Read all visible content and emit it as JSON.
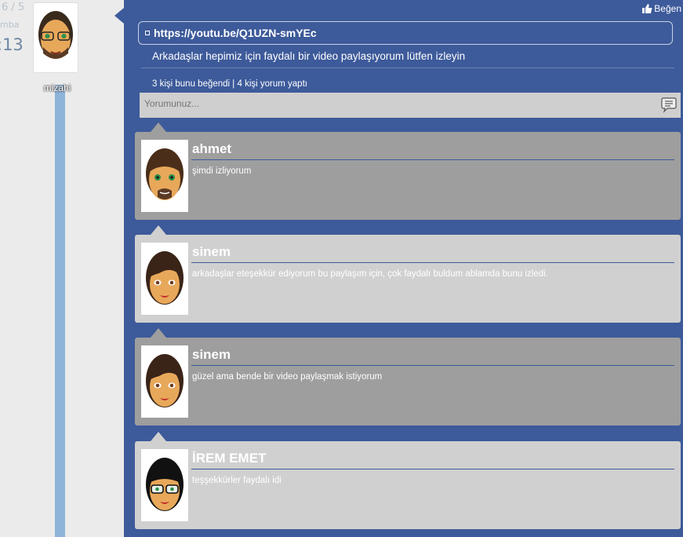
{
  "date": {
    "day": "6 / 5",
    "weekday": "mba",
    "time": ":13"
  },
  "author": {
    "name": "mizahi"
  },
  "post": {
    "like_label": "Beğen",
    "link": "https://youtu.be/Q1UZN-smYEc",
    "text": "Arkadaşlar hepimiz için faydalı bir video paylaşıyorum lütfen izleyin",
    "stats": "3 kişi bunu beğendi | 4 kişi yorum yaptı",
    "comment_placeholder": "Yorumunuz..."
  },
  "comments": [
    {
      "name": "ahmet",
      "text": "şimdi izliyorum"
    },
    {
      "name": "sinem",
      "text": "arkadaşlar eteşekkür ediyorum bu paylaşım için, çok faydalı buldum ablamda bunu izledi."
    },
    {
      "name": "sinem",
      "text": "güzel ama bende bir video paylaşmak istiyorum"
    },
    {
      "name": "İREM EMET",
      "text": "teşşekkürler faydalı idi"
    }
  ],
  "colors": {
    "post_bg": "#3d5a9a",
    "timeline": "#8fb4d9",
    "comment_dark": "#9e9e9e",
    "comment_light": "#d0d0d0"
  }
}
